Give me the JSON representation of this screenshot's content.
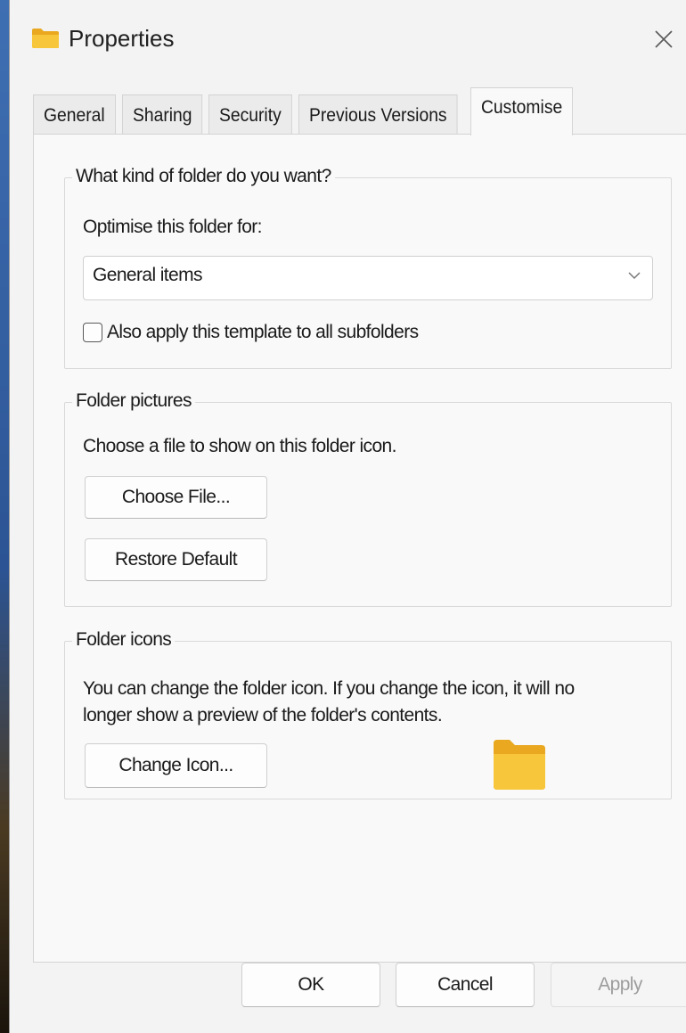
{
  "window": {
    "title": "Properties",
    "title_icon": "folder-icon",
    "close_icon": "close-icon"
  },
  "tabs": [
    {
      "label": "General",
      "active": false
    },
    {
      "label": "Sharing",
      "active": false
    },
    {
      "label": "Security",
      "active": false
    },
    {
      "label": "Previous Versions",
      "active": false
    },
    {
      "label": "Customise",
      "active": true
    }
  ],
  "folder_type": {
    "legend": "What kind of folder do you want?",
    "optimise_label": "Optimise this folder for:",
    "optimise_value": "General items",
    "apply_subfolders_label": "Also apply this template to all subfolders",
    "apply_subfolders_checked": false
  },
  "folder_pictures": {
    "legend": "Folder pictures",
    "description": "Choose a file to show on this folder icon.",
    "choose_file_label": "Choose File...",
    "restore_default_label": "Restore Default"
  },
  "folder_icons": {
    "legend": "Folder icons",
    "description_line1": "You can change the folder icon. If you change the icon, it will no",
    "description_line2": "longer show a preview of the folder's contents.",
    "change_icon_label": "Change Icon...",
    "preview_icon": "folder-icon"
  },
  "footer": {
    "ok_label": "OK",
    "cancel_label": "Cancel",
    "apply_label": "Apply",
    "apply_enabled": false
  },
  "colors": {
    "folder_yellow": "#f8c63a",
    "window_bg": "#f3f3f3",
    "panel_bg": "#f9f9f9"
  }
}
